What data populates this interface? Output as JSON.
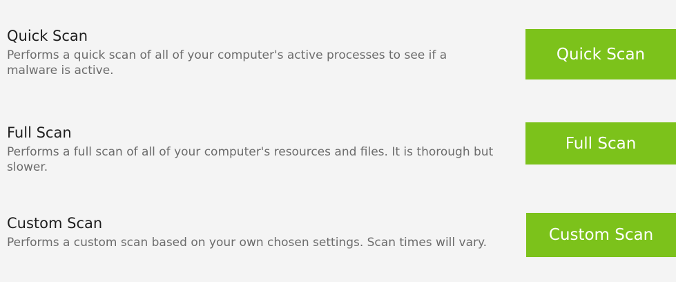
{
  "scans": {
    "quick": {
      "title": "Quick Scan",
      "description": "Performs a quick scan of all of your computer's active processes to see if a malware is active.",
      "button_label": "Quick Scan"
    },
    "full": {
      "title": "Full Scan",
      "description": "Performs a full scan of all of your computer's resources and files. It is thorough but slower.",
      "button_label": "Full Scan"
    },
    "custom": {
      "title": "Custom Scan",
      "description": "Performs a custom scan based on your own chosen settings. Scan times will vary.",
      "button_label": "Custom Scan"
    }
  },
  "colors": {
    "background": "#f4f4f4",
    "button_background": "#7cc21b",
    "button_text": "#ffffff",
    "title_text": "#1e1e1e",
    "description_text": "#6c6c6c"
  }
}
